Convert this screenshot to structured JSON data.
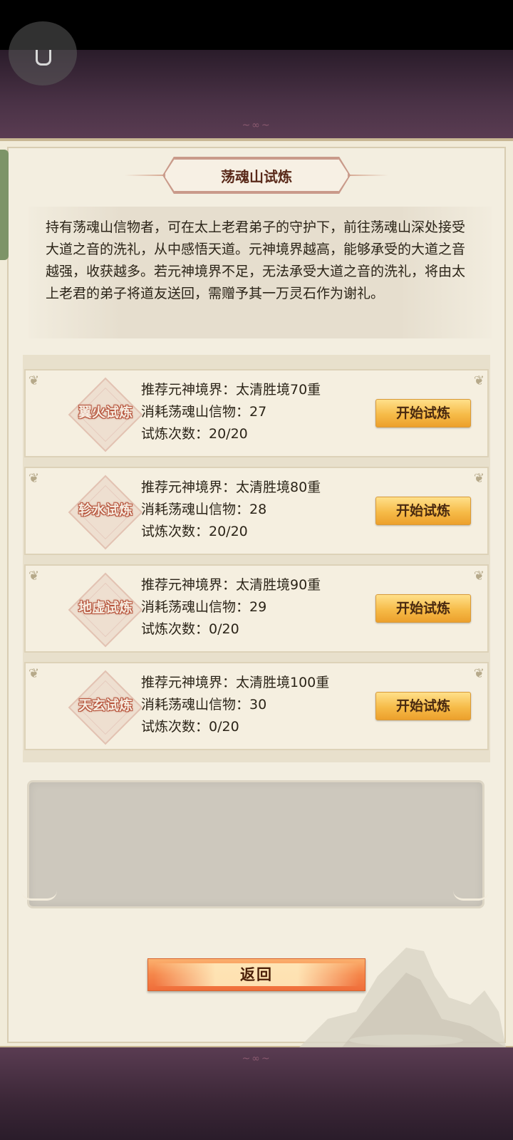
{
  "title": "荡魂山试炼",
  "description": "持有荡魂山信物者，可在太上老君弟子的守护下，前往荡魂山深处接受大道之音的洗礼，从中感悟天道。元神境界越高，能够承受的大道之音越强，收获越多。若元神境界不足，无法承受大道之音的洗礼，将由太上老君的弟子将道友送回，需赠予其一万灵石作为谢礼。",
  "trials": [
    {
      "name": "翼火试炼",
      "recommend": "推荐元神境界：太清胜境70重",
      "cost": "消耗荡魂山信物：27",
      "count": "试炼次数：20/20",
      "button": "开始试炼"
    },
    {
      "name": "轸水试炼",
      "recommend": "推荐元神境界：太清胜境80重",
      "cost": "消耗荡魂山信物：28",
      "count": "试炼次数：20/20",
      "button": "开始试炼"
    },
    {
      "name": "地虚试炼",
      "recommend": "推荐元神境界：太清胜境90重",
      "cost": "消耗荡魂山信物：29",
      "count": "试炼次数：0/20",
      "button": "开始试炼"
    },
    {
      "name": "天玄试炼",
      "recommend": "推荐元神境界：太清胜境100重",
      "cost": "消耗荡魂山信物：30",
      "count": "试炼次数：0/20",
      "button": "开始试炼"
    }
  ],
  "back_button": "返回",
  "colors": {
    "panel": "#f1ebd9",
    "start_button": "#f6bb48",
    "back_button": "#f5864a",
    "backdrop": "#4a3246"
  }
}
